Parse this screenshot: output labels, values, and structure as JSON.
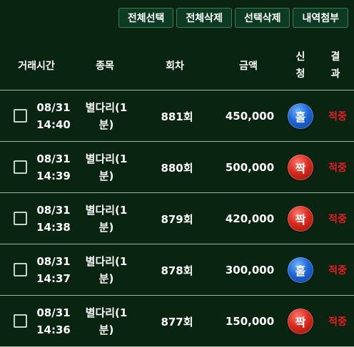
{
  "toolbar": {
    "select_all": "전체선택",
    "delete_all": "전체삭제",
    "delete_selected": "선택삭제",
    "attach_history": "내역첨부"
  },
  "headers": {
    "time": "거래시간",
    "item": "종목",
    "round": "회차",
    "amount": "금액",
    "bet_1": "신",
    "bet_2": "청",
    "result_1": "결",
    "result_2": "과"
  },
  "colors": {
    "background": "#0a2412",
    "hit_text": "#e81e1e",
    "odd_ball": "#1e66d6",
    "even_ball": "#d82a1e"
  },
  "rows": [
    {
      "date": "08/31",
      "time": "14:40",
      "item_1": "별다리(1",
      "item_2": "분)",
      "round": "881회",
      "amount": "450,000",
      "bet": "홀",
      "bet_color": "blue",
      "result": "적중"
    },
    {
      "date": "08/31",
      "time": "14:39",
      "item_1": "별다리(1",
      "item_2": "분)",
      "round": "880회",
      "amount": "500,000",
      "bet": "짝",
      "bet_color": "red",
      "result": "적중"
    },
    {
      "date": "08/31",
      "time": "14:38",
      "item_1": "별다리(1",
      "item_2": "분)",
      "round": "879회",
      "amount": "420,000",
      "bet": "짝",
      "bet_color": "red",
      "result": "적중"
    },
    {
      "date": "08/31",
      "time": "14:37",
      "item_1": "별다리(1",
      "item_2": "분)",
      "round": "878회",
      "amount": "300,000",
      "bet": "홀",
      "bet_color": "blue",
      "result": "적중"
    },
    {
      "date": "08/31",
      "time": "14:36",
      "item_1": "별다리(1",
      "item_2": "분)",
      "round": "877회",
      "amount": "150,000",
      "bet": "짝",
      "bet_color": "red",
      "result": "적중"
    }
  ]
}
